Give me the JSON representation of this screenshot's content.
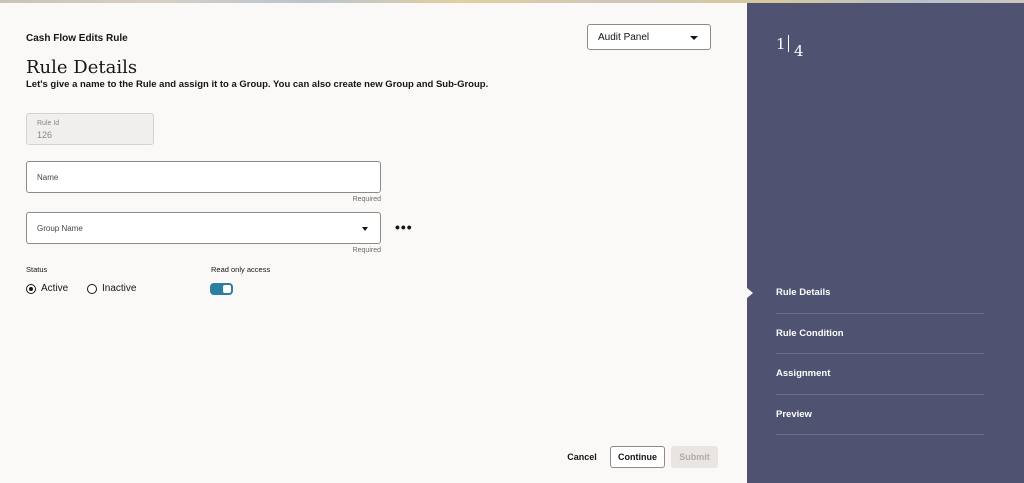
{
  "header": {
    "app_title": "Cash Flow Edits Rule",
    "panel_select": {
      "value": "Audit Panel"
    }
  },
  "form": {
    "title": "Rule Details",
    "subtitle": "Let's give a name to the Rule and assign it to a Group. You can also create new Group and Sub-Group.",
    "rule_id": {
      "label": "Rule Id",
      "value": "126"
    },
    "name": {
      "label": "Name",
      "value": "",
      "required_text": "Required"
    },
    "group_name": {
      "label": "Group Name",
      "value": "",
      "required_text": "Required"
    },
    "more_label": "•••",
    "status": {
      "label": "Status",
      "options": [
        {
          "label": "Active",
          "selected": true
        },
        {
          "label": "Inactive",
          "selected": false
        }
      ]
    },
    "read_only_access": {
      "label": "Read only access",
      "on": true
    }
  },
  "footer": {
    "cancel_label": "Cancel",
    "continue_label": "Continue",
    "submit_label": "Submit"
  },
  "progress": {
    "current": "1",
    "total": "4",
    "steps": [
      {
        "label": "Rule Details",
        "current": true
      },
      {
        "label": "Rule Condition",
        "current": false
      },
      {
        "label": "Assignment",
        "current": false
      },
      {
        "label": "Preview",
        "current": false
      }
    ]
  },
  "colors": {
    "sidebar_bg": "#4f5270",
    "toggle_on": "#2a7fa3",
    "page_bg": "#fbf9f8"
  }
}
